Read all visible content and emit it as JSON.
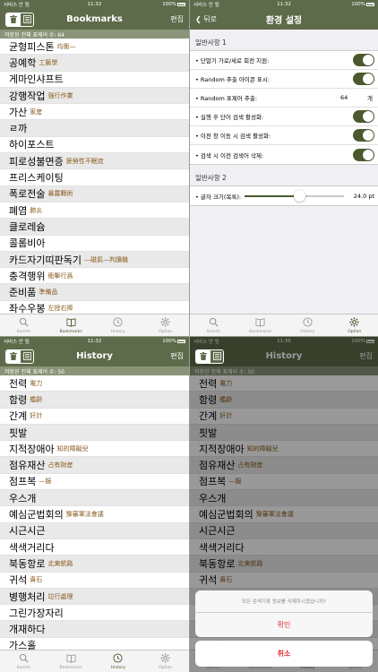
{
  "status": {
    "carrier": "서비스 안 됨",
    "battery": "100%",
    "time_a": "11:32",
    "time_b": "11:36"
  },
  "bookmarks": {
    "title": "Bookmarks",
    "edit": "편집",
    "count": "저장된 전체 표제어 수: 64",
    "items": [
      {
        "word": "균형피스톤",
        "han": "均衡—"
      },
      {
        "word": "공예학",
        "han": "工藝學"
      },
      {
        "word": "게마인샤프트",
        "han": ""
      },
      {
        "word": "강행작업",
        "han": "强行作業"
      },
      {
        "word": "가산",
        "han": "家産"
      },
      {
        "word": "ㄹ까",
        "han": ""
      },
      {
        "word": "하이포스트",
        "han": ""
      },
      {
        "word": "피로성불면증",
        "han": "疲勞性不眠症"
      },
      {
        "word": "프리스케이팅",
        "han": ""
      },
      {
        "word": "폭로전술",
        "han": "暴露戰術"
      },
      {
        "word": "폐염",
        "han": "肺炎"
      },
      {
        "word": "클로레슘",
        "han": ""
      },
      {
        "word": "콜롬비아",
        "han": ""
      },
      {
        "word": "카드자기띠판독기",
        "han": "—磁氣—判讀機"
      },
      {
        "word": "충격행위",
        "han": "衝擊行爲"
      },
      {
        "word": "준비품",
        "han": "準備品"
      },
      {
        "word": "좌수우봉",
        "han": "左授右捧"
      }
    ]
  },
  "settings": {
    "back": "뒤로",
    "title": "환경 설정",
    "section1": "일반사항 1",
    "rows": [
      {
        "label": "• 단말기 가로/세로 회전 지원:"
      },
      {
        "label": "• Random 추출 아이콘 표시:"
      },
      {
        "label": "• Random 표제어 추출:",
        "value": "64",
        "unit": "개"
      },
      {
        "label": "• 실행 후 단어 검색 활성화:"
      },
      {
        "label": "• 이전 창 이동 시 검색 활성화:"
      },
      {
        "label": "• 검색 시 이전 검색어 삭제:"
      }
    ],
    "section2": "일반사항 2",
    "font_label": "• 글자 크기(목록):",
    "font_value": "24.0 pt",
    "font_level": 0.55
  },
  "history": {
    "title": "History",
    "edit": "편집",
    "count": "저장된 전체 표제어 수: 50",
    "items": [
      {
        "word": "전력",
        "han": "電力"
      },
      {
        "word": "함령",
        "han": "艦齡"
      },
      {
        "word": "간계",
        "han": "奸計"
      },
      {
        "word": "핏발",
        "han": ""
      },
      {
        "word": "지적장애아",
        "han": "知的障礙兒"
      },
      {
        "word": "점유재산",
        "han": "占有財産"
      },
      {
        "word": "점프복",
        "han": "—服"
      },
      {
        "word": "우스개",
        "han": ""
      },
      {
        "word": "예심군법회의",
        "han": "豫審軍法會議"
      },
      {
        "word": "시근시근",
        "han": ""
      },
      {
        "word": "색색거리다",
        "han": ""
      },
      {
        "word": "북동항로",
        "han": "北東航路"
      },
      {
        "word": "귀석",
        "han": "貴石"
      },
      {
        "word": "병행처리",
        "han": "竝行處理"
      },
      {
        "word": "그린가장자리",
        "han": ""
      },
      {
        "word": "개재하다",
        "han": ""
      },
      {
        "word": "가스홀",
        "han": ""
      }
    ]
  },
  "dialog": {
    "message": "모든 검색기록 정보를 삭제하시겠습니까?",
    "confirm": "확인",
    "cancel": "취소"
  },
  "tabs": {
    "search": "Search",
    "bookmarks": "Bookmarks",
    "history": "History",
    "option": "Option"
  }
}
